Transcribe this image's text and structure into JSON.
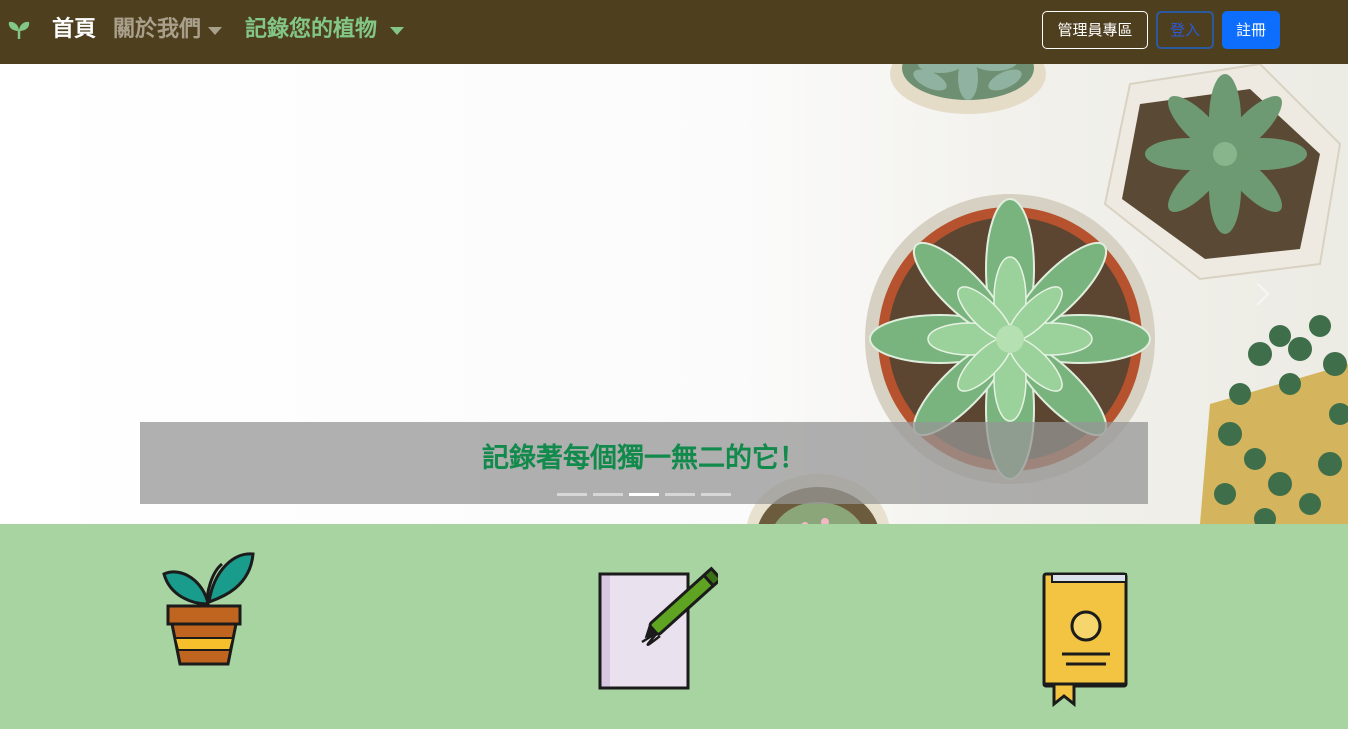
{
  "navbar": {
    "brand_icon": "sprout-icon",
    "home_label": "首頁",
    "about_label": "關於我們",
    "record_label": "記錄您的植物",
    "admin_label": "管理員專區",
    "login_label": "登入",
    "register_label": "註冊",
    "colors": {
      "background": "#4e3f1f",
      "active": "#82c785",
      "muted": "#a9a08b",
      "primary": "#0d6efd"
    }
  },
  "carousel": {
    "caption": "記錄著每個獨一無二的它！",
    "slide_count": 5,
    "active_slide": 3,
    "prev_icon": "chevron-left-icon",
    "next_icon": "chevron-right-icon"
  },
  "features": {
    "background": "#a8d4a2",
    "items": [
      {
        "icon": "potted-plant-icon"
      },
      {
        "icon": "notebook-pen-icon"
      },
      {
        "icon": "book-bookmark-icon"
      }
    ]
  }
}
